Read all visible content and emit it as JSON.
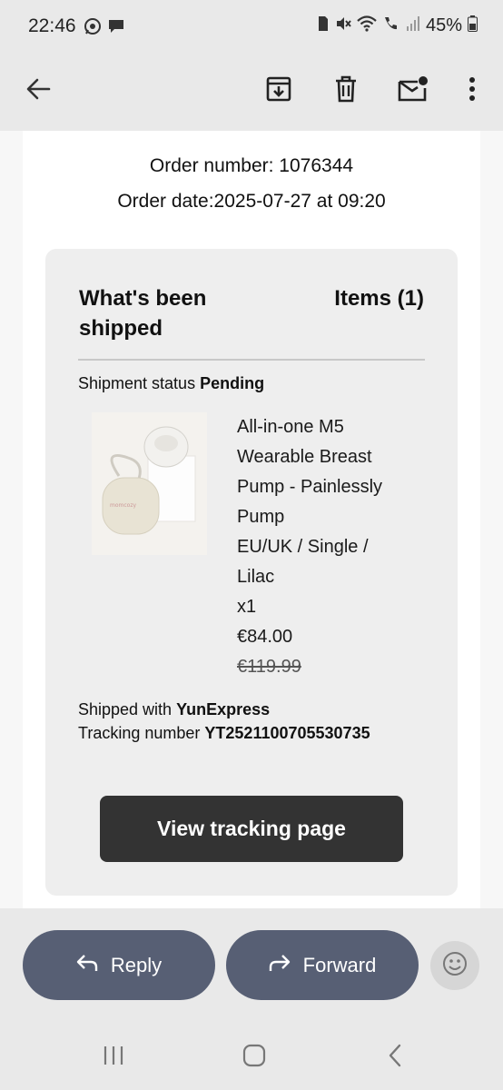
{
  "status_bar": {
    "time": "22:46",
    "battery": "45%",
    "left_icons": [
      "whatsapp-icon",
      "chat-icon"
    ],
    "right_icons": [
      "sim-icon",
      "mute-icon",
      "wifi-icon",
      "wifi-call-icon",
      "signal-icon",
      "battery-icon"
    ]
  },
  "toolbar": {
    "back_icon": "arrow-back-icon",
    "archive_icon": "archive-icon",
    "delete_icon": "trash-icon",
    "mark_unread_icon": "mark-unread-icon",
    "more_icon": "more-vert-icon"
  },
  "order": {
    "number_line": "Order number: 1076344",
    "date_line": "Order date:2025-07-27 at 09:20"
  },
  "card": {
    "title": "What's been shipped",
    "items_count": "Items (1)",
    "shipment_status_label": "Shipment status",
    "shipment_status_value": "Pending",
    "product": {
      "image_icon": "breast-pump-product-image",
      "name_lines": [
        "All-in-one M5",
        "Wearable Breast",
        "Pump - Painlessly",
        "Pump"
      ],
      "variant_lines": [
        "EU/UK / Single /",
        "Lilac"
      ],
      "quantity": "x1",
      "price": "€84.00",
      "original_price": "€119.99"
    },
    "shipped_with_label": "Shipped with",
    "shipped_with_value": "YunExpress",
    "tracking_label": "Tracking number",
    "tracking_value": "YT2521100705530735",
    "tracking_button": "View tracking page"
  },
  "actions": {
    "reply_label": "Reply",
    "forward_label": "Forward",
    "reply_icon": "reply-icon",
    "forward_icon": "forward-icon",
    "emoji_icon": "emoji-icon"
  },
  "nav": {
    "recents_icon": "recents-icon",
    "home_icon": "home-icon",
    "back_icon": "nav-back-icon"
  },
  "colors": {
    "pill_bg": "#575f74",
    "button_dark": "#333333",
    "card_bg": "#eeeeee",
    "chrome_bg": "#e9e9e9"
  }
}
